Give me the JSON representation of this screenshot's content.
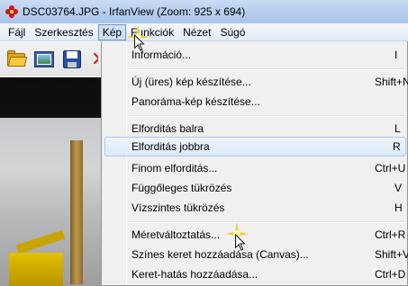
{
  "window": {
    "title": "DSC03764.JPG - IrfanView (Zoom: 925 x 694)"
  },
  "menubar": {
    "items": [
      "Fájl",
      "Szerkesztés",
      "Kép",
      "Funkciók",
      "Nézet",
      "Súgó"
    ],
    "active_index": 2
  },
  "toolbar": {
    "buttons": [
      "open-folder-icon",
      "slideshow-icon",
      "save-disk-icon",
      "delete-icon"
    ]
  },
  "kep_menu": {
    "items": [
      {
        "label": "Információ...",
        "shortcut": "I"
      },
      {
        "label": "Új (üres) kép készítése...",
        "shortcut": "Shift+N"
      },
      {
        "label": "Panoráma-kép készítése...",
        "shortcut": ""
      },
      {
        "label": "Elforditás balra",
        "shortcut": "L"
      },
      {
        "label": "Elforditás jobbra",
        "shortcut": "R"
      },
      {
        "label": "Finom elforditás...",
        "shortcut": "Ctrl+U"
      },
      {
        "label": "Függőleges tükrözés",
        "shortcut": "V"
      },
      {
        "label": "Vízszintes tükrözés",
        "shortcut": "H"
      },
      {
        "label": "Méretváltoztatás...",
        "shortcut": "Ctrl+R"
      },
      {
        "label": "Színes keret hozzáadása (Canvas)...",
        "shortcut": "Shift+V"
      },
      {
        "label": "Keret-hatás hozzáadása...",
        "shortcut": "Ctrl+D"
      }
    ],
    "highlighted_index": 4
  },
  "colors": {
    "menu_highlight": "#dde9f9",
    "menu_highlight_border": "#a8c8ee",
    "title_bar": "#b6cfee"
  }
}
